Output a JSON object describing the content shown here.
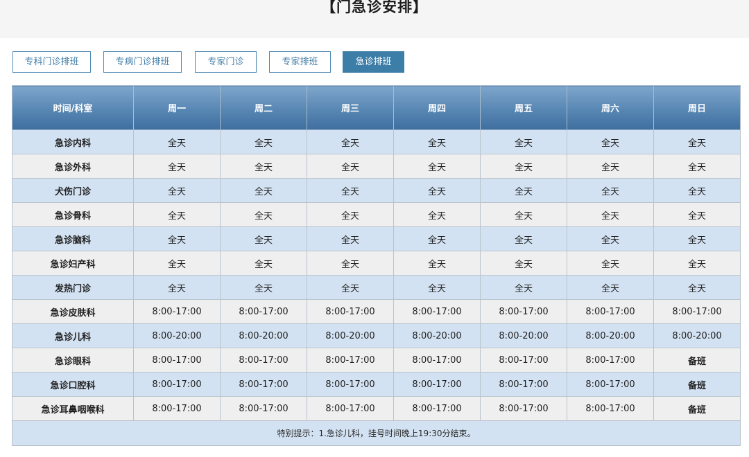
{
  "page": {
    "title": "【门急诊安排】"
  },
  "tabs": [
    {
      "label": "专科门诊排班",
      "active": false
    },
    {
      "label": "专病门诊排班",
      "active": false
    },
    {
      "label": "专家门诊",
      "active": false
    },
    {
      "label": "专家排班",
      "active": false
    },
    {
      "label": "急诊排班",
      "active": true
    }
  ],
  "table": {
    "headers": [
      "时间/科室",
      "周一",
      "周二",
      "周三",
      "周四",
      "周五",
      "周六",
      "周日"
    ],
    "rows": [
      {
        "dept": "急诊内科",
        "cells": [
          "全天",
          "全天",
          "全天",
          "全天",
          "全天",
          "全天",
          "全天"
        ]
      },
      {
        "dept": "急诊外科",
        "cells": [
          "全天",
          "全天",
          "全天",
          "全天",
          "全天",
          "全天",
          "全天"
        ]
      },
      {
        "dept": "犬伤门诊",
        "cells": [
          "全天",
          "全天",
          "全天",
          "全天",
          "全天",
          "全天",
          "全天"
        ]
      },
      {
        "dept": "急诊骨科",
        "cells": [
          "全天",
          "全天",
          "全天",
          "全天",
          "全天",
          "全天",
          "全天"
        ]
      },
      {
        "dept": "急诊脑科",
        "cells": [
          "全天",
          "全天",
          "全天",
          "全天",
          "全天",
          "全天",
          "全天"
        ]
      },
      {
        "dept": "急诊妇产科",
        "cells": [
          "全天",
          "全天",
          "全天",
          "全天",
          "全天",
          "全天",
          "全天"
        ]
      },
      {
        "dept": "发热门诊",
        "cells": [
          "全天",
          "全天",
          "全天",
          "全天",
          "全天",
          "全天",
          "全天"
        ]
      },
      {
        "dept": "急诊皮肤科",
        "cells": [
          "8:00-17:00",
          "8:00-17:00",
          "8:00-17:00",
          "8:00-17:00",
          "8:00-17:00",
          "8:00-17:00",
          "8:00-17:00"
        ]
      },
      {
        "dept": "急诊儿科",
        "cells": [
          "8:00-20:00",
          "8:00-20:00",
          "8:00-20:00",
          "8:00-20:00",
          "8:00-20:00",
          "8:00-20:00",
          "8:00-20:00"
        ]
      },
      {
        "dept": "急诊眼科",
        "cells": [
          "8:00-17:00",
          "8:00-17:00",
          "8:00-17:00",
          "8:00-17:00",
          "8:00-17:00",
          "8:00-17:00",
          "备班"
        ]
      },
      {
        "dept": "急诊口腔科",
        "cells": [
          "8:00-17:00",
          "8:00-17:00",
          "8:00-17:00",
          "8:00-17:00",
          "8:00-17:00",
          "8:00-17:00",
          "备班"
        ]
      },
      {
        "dept": "急诊耳鼻咽喉科",
        "cells": [
          "8:00-17:00",
          "8:00-17:00",
          "8:00-17:00",
          "8:00-17:00",
          "8:00-17:00",
          "8:00-17:00",
          "备班"
        ]
      }
    ],
    "note": "特别提示：1.急诊儿科，挂号时间晚上19:30分结束。"
  },
  "colors": {
    "accent": "#3d7ea8",
    "header_gradient_top": "#7ea6cb",
    "header_gradient_bottom": "#3e6e9f",
    "row_blue": "#d3e2f2",
    "row_gray": "#efefef"
  }
}
